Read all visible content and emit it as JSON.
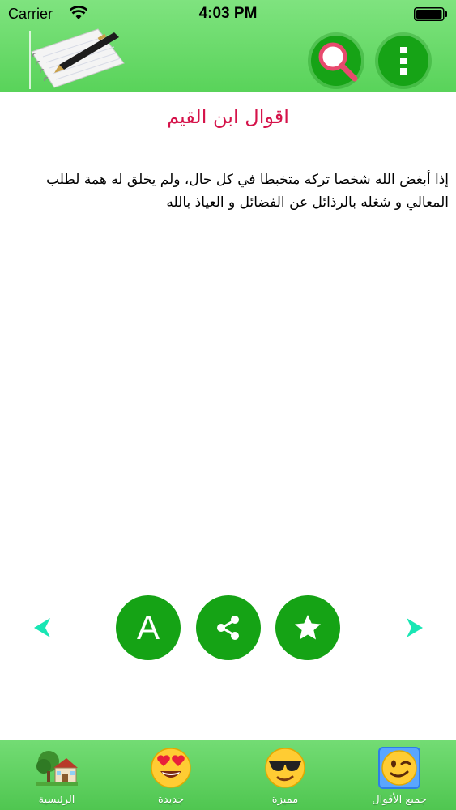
{
  "status_bar": {
    "carrier": "Carrier",
    "time": "4:03 PM",
    "wifi_icon": "wifi-icon",
    "battery_icon": "battery-icon"
  },
  "header": {
    "logo_icon": "notebook-pen-icon",
    "search_icon": "search-icon",
    "menu_icon": "vertical-dots-icon"
  },
  "content": {
    "title": "اقوال ابن القيم",
    "quote": "إذا أبغض الله شخصا تركه متخبطا في كل حال، ولم يخلق له همة لطلب المعالي و شغله بالرذائل عن الفضائل و العياذ بالله"
  },
  "actions": {
    "font_label": "A",
    "share_icon": "share-icon",
    "favorite_icon": "star-icon",
    "prev_icon": "chevron-left-icon",
    "next_icon": "chevron-right-icon"
  },
  "tabbar": {
    "tabs": [
      {
        "label": "الرئيسية",
        "icon": "house-tree-emoji"
      },
      {
        "label": "جديدة",
        "icon": "heart-eyes-emoji"
      },
      {
        "label": "مميزة",
        "icon": "sunglasses-emoji"
      },
      {
        "label": "جميع الأقوال",
        "icon": "winking-face-emoji"
      }
    ],
    "selected_index": 3
  },
  "colors": {
    "header_green": "#59d35a",
    "button_green": "#16a316",
    "title_red": "#d5134a",
    "arrow_teal": "#18e6b4"
  }
}
